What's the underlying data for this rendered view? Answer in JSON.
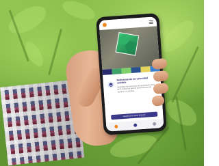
{
  "scene": {
    "subject": "hand-holding-smartphone-in-crop-field"
  },
  "app": {
    "card_title": "Refinamiento de velocidad variable",
    "card_body": "Identifique las secciones de rendimiento antes de la cosecha y genere prescripciones de siembra a la medida.",
    "cta_label": "Guarde para usarlo después"
  },
  "colors": {
    "accent": "#3b3a8a",
    "brand_orange": "#f08a24",
    "field_green": "#2fb36a"
  },
  "icons": {
    "app_logo": "logo-icon",
    "menu": "menu-icon",
    "card_badge": "layers-icon",
    "nav": [
      "home-icon",
      "map-icon",
      "profile-icon"
    ]
  }
}
